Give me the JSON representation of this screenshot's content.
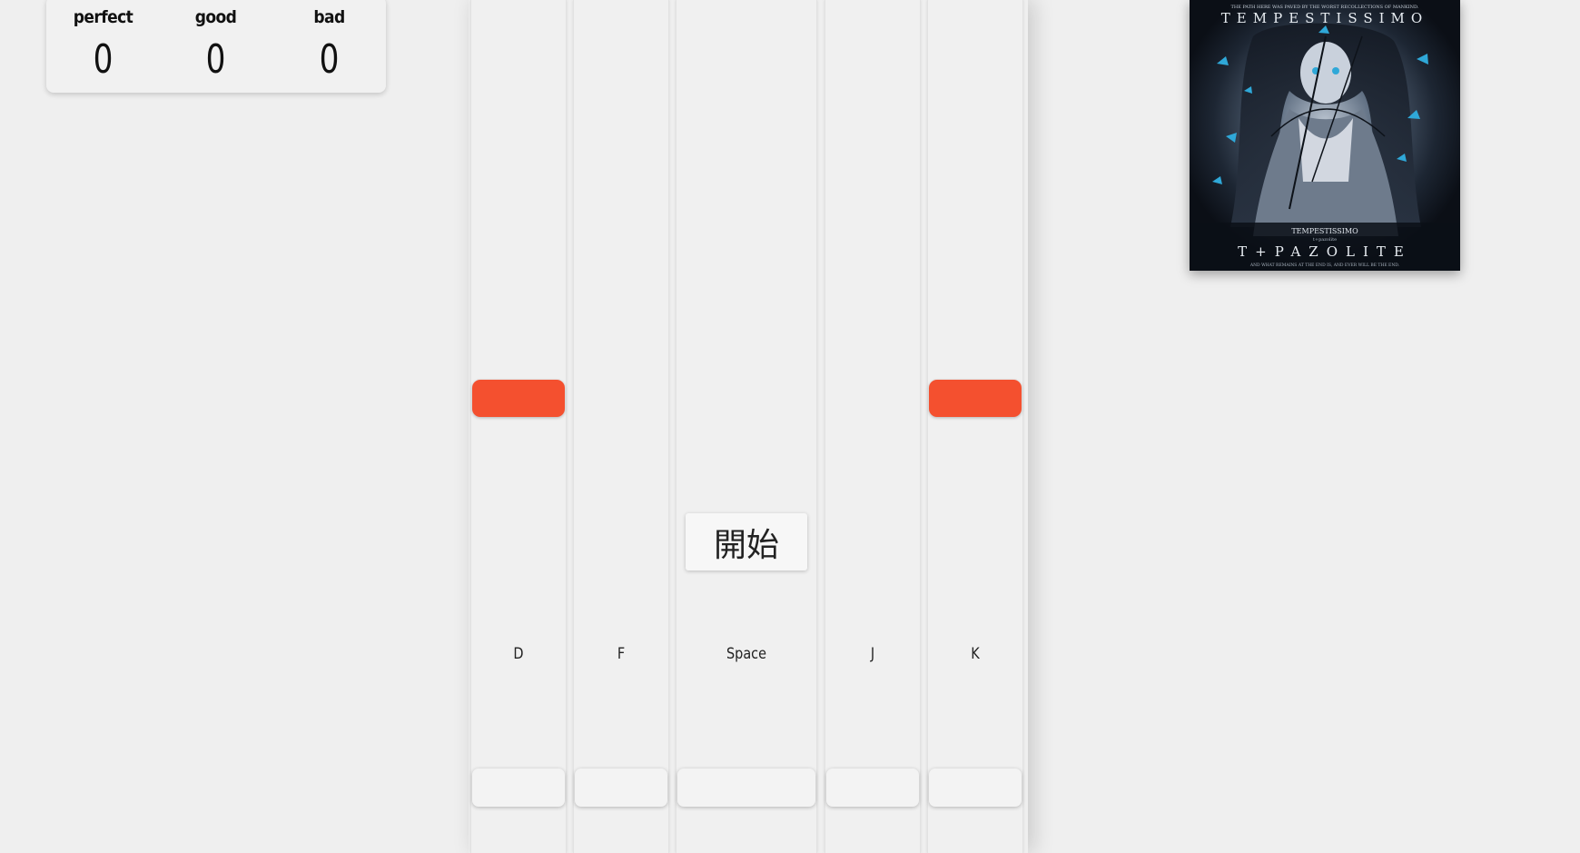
{
  "scoreboard": {
    "perfect": {
      "label": "perfect",
      "value": "0"
    },
    "good": {
      "label": "good",
      "value": "0"
    },
    "bad": {
      "label": "bad",
      "value": "0"
    }
  },
  "lanes": [
    {
      "key": "D"
    },
    {
      "key": "F"
    },
    {
      "key": "Space"
    },
    {
      "key": "J"
    },
    {
      "key": "K"
    }
  ],
  "notes": [
    {
      "lane": "D"
    },
    {
      "lane": "K"
    }
  ],
  "start_button": {
    "label": "開始"
  },
  "album_cover": {
    "top_tagline": "THE PATH HERE WAS PAVED BY THE WORST RECOLLECTIONS OF MANKIND.",
    "title": "TEMPESTISSIMO",
    "small_title": "TEMPESTISSIMO",
    "small_artist": "t+pazolite",
    "artist": "T+PAZOLITE",
    "bottom_tagline": "AND WHAT REMAINS AT THE END IS, AND EVER WILL BE THE END."
  },
  "colors": {
    "background": "#efefef",
    "note": "#f4502f",
    "lane": "#f0f0f0",
    "cover_dark": "#1a2230",
    "cover_accent": "#2fa8d8"
  }
}
